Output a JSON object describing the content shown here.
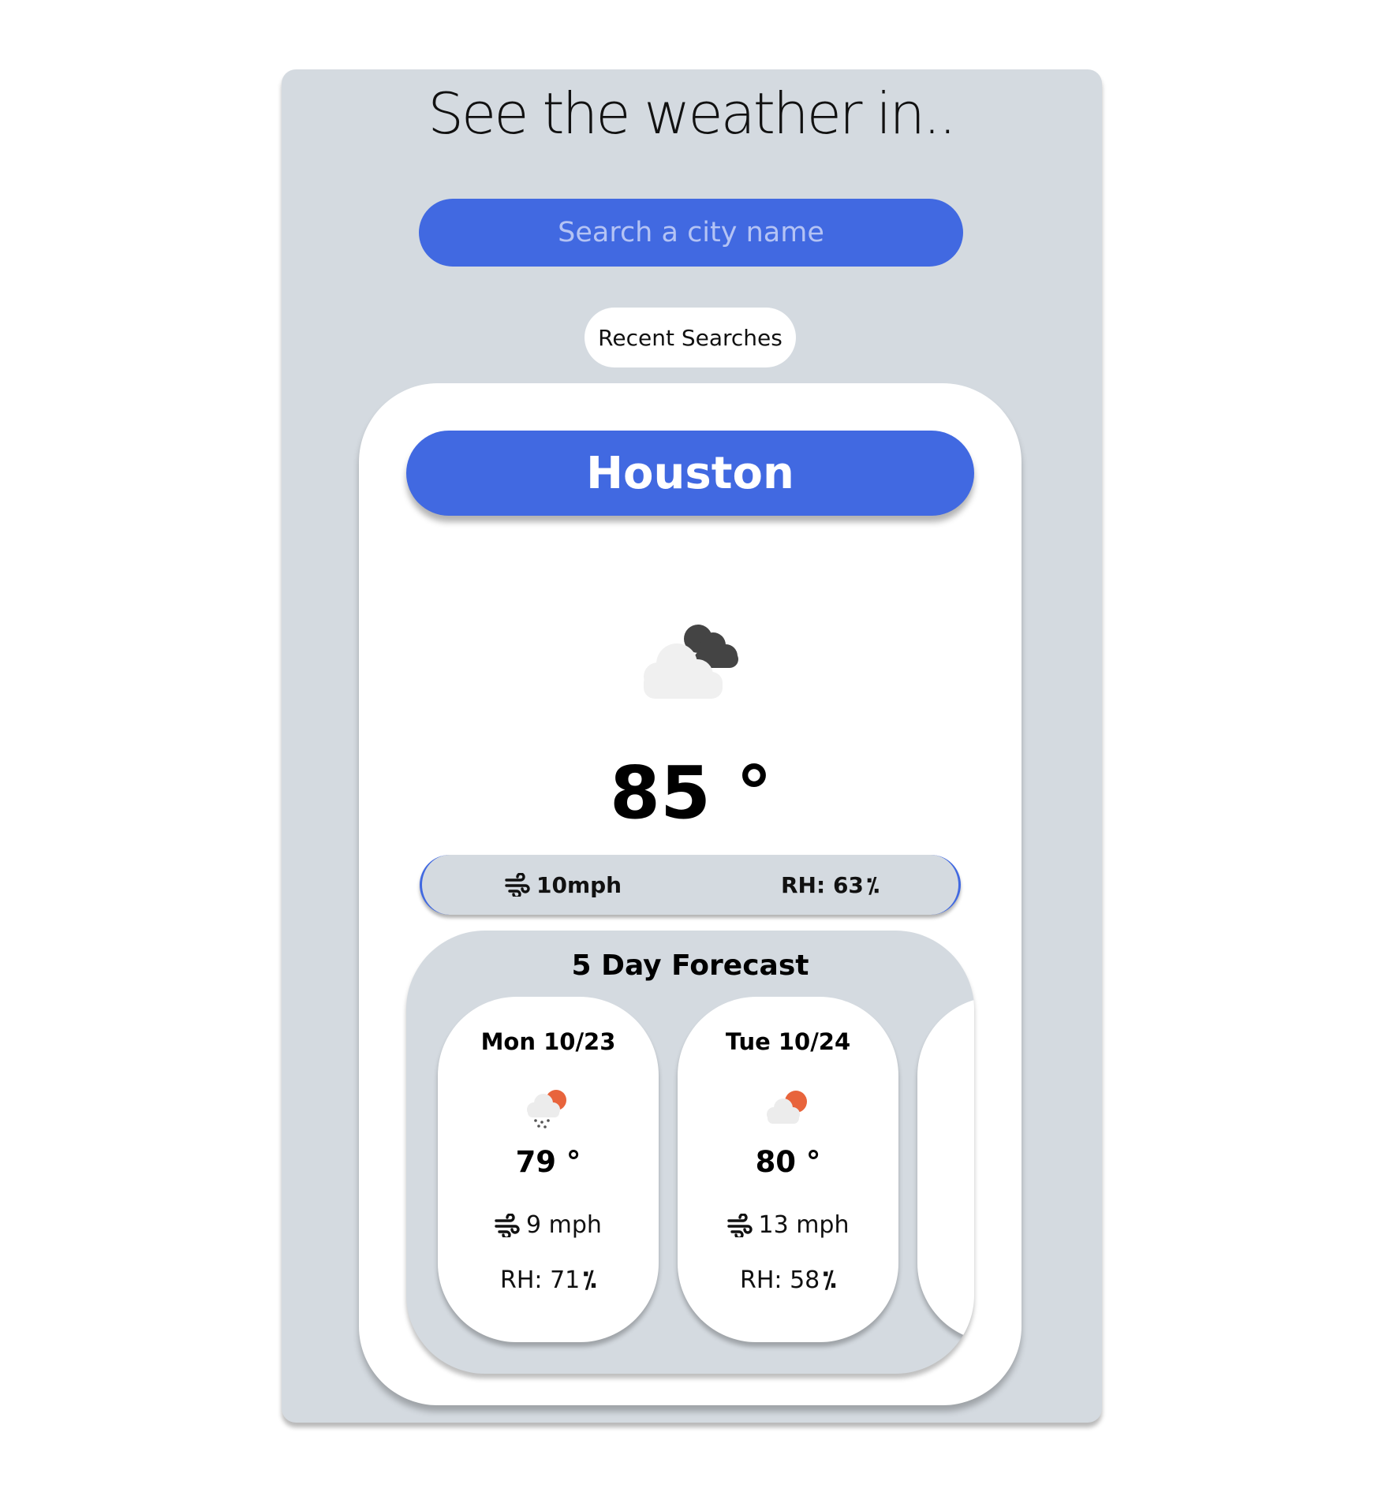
{
  "header": {
    "title": "See the weather in.."
  },
  "search": {
    "placeholder": "Search a city name",
    "value": ""
  },
  "recent": {
    "label": "Recent Searches"
  },
  "current": {
    "city": "Houston",
    "icon": "cloudy-icon",
    "temp": "85 °",
    "wind": "10mph",
    "humidity_label": "RH: 63",
    "percent_glyph": "⁒"
  },
  "forecast": {
    "title": "5 Day Forecast",
    "days": [
      {
        "date": "Mon 10/23",
        "icon": "rain-sun-icon",
        "temp": "79 °",
        "wind": "9 mph",
        "humidity": "RH: 71"
      },
      {
        "date": "Tue 10/24",
        "icon": "partly-cloudy-icon",
        "temp": "80 °",
        "wind": "13 mph",
        "humidity": "RH: 58"
      }
    ]
  },
  "colors": {
    "accent": "#4169e1",
    "panel": "#d4dae0",
    "sun": "#e8643c"
  }
}
